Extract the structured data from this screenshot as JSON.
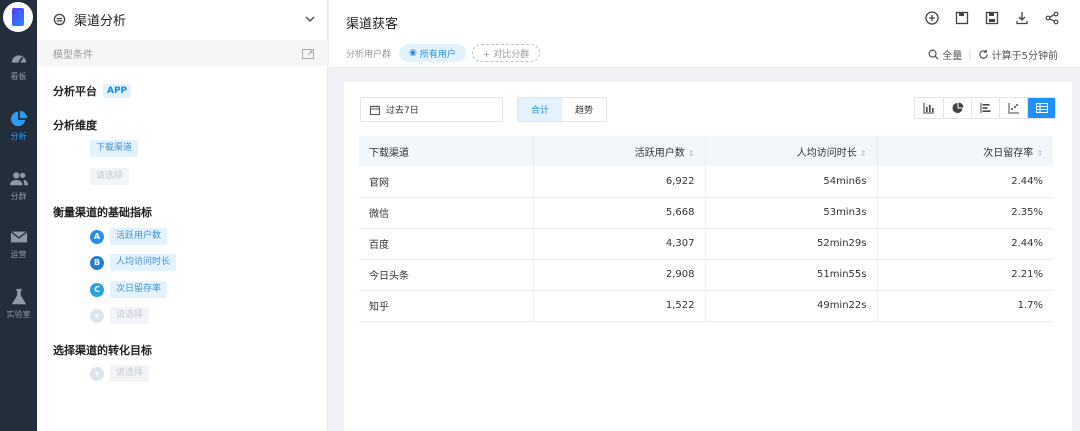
{
  "nav": {
    "items": [
      {
        "label": "看板",
        "icon": "dashboard-gauge-icon"
      },
      {
        "label": "分析",
        "icon": "pie-chart-icon"
      },
      {
        "label": "分群",
        "icon": "users-icon"
      },
      {
        "label": "运营",
        "icon": "mail-icon"
      },
      {
        "label": "实验室",
        "icon": "flask-icon"
      }
    ],
    "active": "分析"
  },
  "panel": {
    "title": "渠道分析",
    "model_conditions": "模型条件",
    "platform_label": "分析平台",
    "platform_value": "APP",
    "dimension_label": "分析维度",
    "dimension_value": "下载渠道",
    "dimension_add": "请选择",
    "metrics_label": "衡量渠道的基础指标",
    "metrics": [
      {
        "badge": "A",
        "label": "活跃用户数"
      },
      {
        "badge": "B",
        "label": "人均访问时长"
      },
      {
        "badge": "C",
        "label": "次日留存率"
      }
    ],
    "metric_add": "请选择",
    "goal_label": "选择渠道的转化目标",
    "goal_add": "请选择"
  },
  "main": {
    "title": "渠道获客",
    "segment_label": "分析用户群",
    "segment_value": "所有用户",
    "segment_compare": "+ 对比分群",
    "fullscreen": "全量",
    "computed_at": "计算于5分钟前"
  },
  "card": {
    "date_range": "过去7日",
    "modes": [
      "合计",
      "趋势"
    ],
    "active_mode": "合计"
  },
  "table": {
    "headers": [
      "下载渠道",
      "活跃用户数",
      "人均访问时长",
      "次日留存率"
    ],
    "rows": [
      [
        "官网",
        "6,922",
        "54min6s",
        "2.44%"
      ],
      [
        "微信",
        "5,668",
        "53min3s",
        "2.35%"
      ],
      [
        "百度",
        "4,307",
        "52min29s",
        "2.44%"
      ],
      [
        "今日头条",
        "2,908",
        "51min55s",
        "2.21%"
      ],
      [
        "知乎",
        "1,522",
        "49min22s",
        "1.7%"
      ]
    ]
  },
  "colors": {
    "nav_bg": "#232e3d",
    "accent": "#1e90ff",
    "chip_bg": "#e4f2fd"
  }
}
